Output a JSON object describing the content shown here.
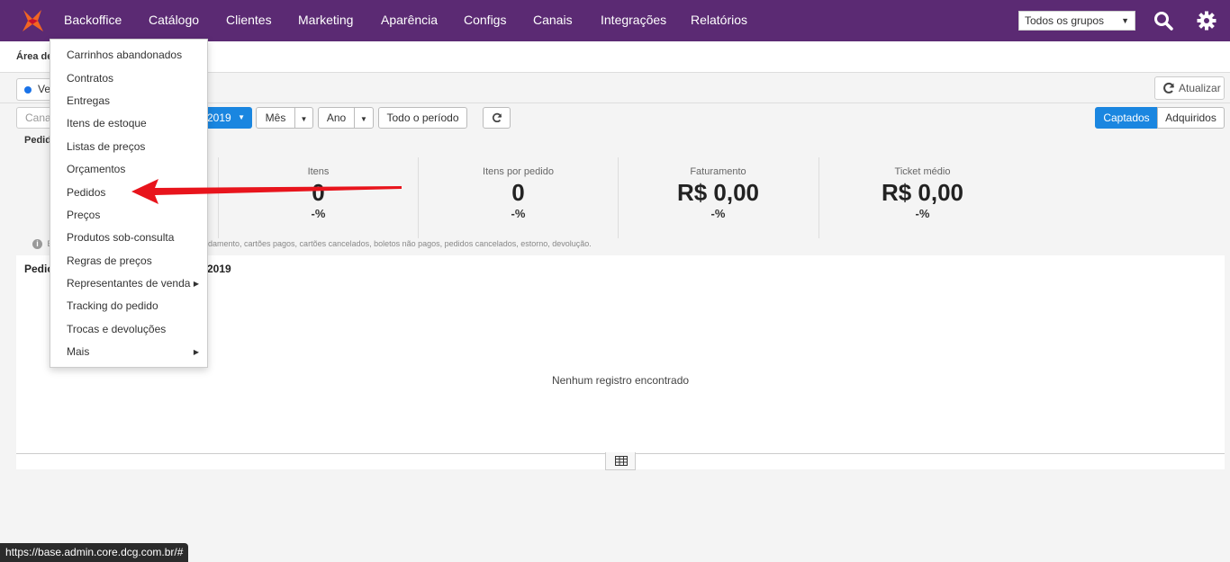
{
  "nav": {
    "items": [
      "Backoffice",
      "Catálogo",
      "Clientes",
      "Marketing",
      "Aparência",
      "Configs",
      "Canais",
      "Integrações",
      "Relatórios"
    ],
    "group_select": "Todos os grupos"
  },
  "breadcrumb": "Área de",
  "tab_pill": "Ve",
  "refresh_top": "Atualizar",
  "filters": {
    "canal_placeholder": "Canal",
    "date_label": "2019",
    "mes": "Mês",
    "ano": "Ano",
    "todo_periodo": "Todo o período",
    "captados": "Captados",
    "adquiridos": "Adquiridos"
  },
  "pedidos_label": "Pedid",
  "metrics": [
    {
      "label": "Itens",
      "value": "0",
      "delta": "-%"
    },
    {
      "label": "Itens por pedido",
      "value": "0",
      "delta": "-%"
    },
    {
      "label": "Faturamento",
      "value": "R$ 0,00",
      "delta": "-%"
    },
    {
      "label": "Ticket médio",
      "value": "R$ 0,00",
      "delta": "-%"
    }
  ],
  "info_note": {
    "prefix": "E",
    "text": "damento, cartões pagos, cartões cancelados, boletos não pagos, pedidos cancelados, estorno, devolução."
  },
  "table": {
    "title_prefix": "Pedic",
    "title_year": "2019",
    "empty": "Nenhum registro encontrado"
  },
  "dropdown": {
    "items": [
      {
        "label": "Carrinhos abandonados",
        "submenu": false
      },
      {
        "label": "Contratos",
        "submenu": false
      },
      {
        "label": "Entregas",
        "submenu": false
      },
      {
        "label": "Itens de estoque",
        "submenu": false
      },
      {
        "label": "Listas de preços",
        "submenu": false
      },
      {
        "label": "Orçamentos",
        "submenu": false
      },
      {
        "label": "Pedidos",
        "submenu": false
      },
      {
        "label": "Preços",
        "submenu": false
      },
      {
        "label": "Produtos sob-consulta",
        "submenu": false
      },
      {
        "label": "Regras de preços",
        "submenu": false
      },
      {
        "label": "Representantes de venda",
        "submenu": true
      },
      {
        "label": "Tracking do pedido",
        "submenu": false
      },
      {
        "label": "Trocas e devoluções",
        "submenu": false
      },
      {
        "label": "Mais",
        "submenu": true
      }
    ]
  },
  "status_url": "https://base.admin.core.dcg.com.br/#",
  "colors": {
    "nav_bg": "#5b2a73",
    "accent": "#1a86e0",
    "annotation_arrow": "#e8141c"
  }
}
